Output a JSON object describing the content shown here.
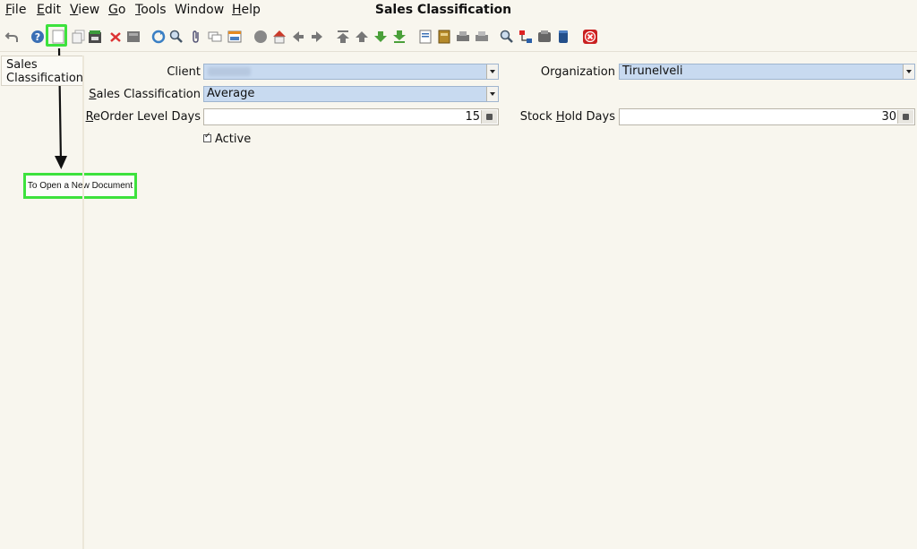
{
  "menubar": {
    "file": "File",
    "edit": "Edit",
    "view": "View",
    "go": "Go",
    "tools": "Tools",
    "window": "Window",
    "help": "Help"
  },
  "window_title": "Sales Classification",
  "toolbar": {
    "icons": [
      "undo-icon",
      "help-icon",
      "new-document-icon",
      "copy-record-icon",
      "save-icon",
      "delete-icon",
      "find-icon",
      "refresh-icon",
      "zoom-search-icon",
      "attachment-icon",
      "chat-icon",
      "grid-toggle-icon",
      "history-icon",
      "home-icon",
      "back-icon",
      "forward-icon",
      "first-record-icon",
      "previous-record-icon",
      "next-record-icon",
      "last-record-icon",
      "report-icon",
      "archive-icon",
      "print-preview-icon",
      "print-icon",
      "zoom-across-icon",
      "workflow-icon",
      "process-icon",
      "product-info-icon",
      "close-window-icon"
    ]
  },
  "annotation": {
    "tooltip": "To Open a New Document",
    "highlight_color": "#3de23d"
  },
  "sidebar": {
    "tab_label_line1": "Sales",
    "tab_label_line2": "Classification"
  },
  "form": {
    "client": {
      "label": "Client",
      "value": ""
    },
    "organization": {
      "label": "Organization",
      "value": "Tirunelveli"
    },
    "sales_classification": {
      "label_ul": "S",
      "label_rest": "ales Classification",
      "value": "Average"
    },
    "reorder_level_days": {
      "label_ul": "R",
      "label_rest": "eOrder Level Days",
      "value": "15"
    },
    "stock_hold_days": {
      "label_pre": "Stock ",
      "label_ul": "H",
      "label_rest": "old Days",
      "value": "30"
    },
    "active": {
      "label": "Active",
      "checked": true
    }
  },
  "colors": {
    "background": "#f8f6ee",
    "combo_fill": "#c8daf0",
    "accent_green": "#3de23d"
  }
}
